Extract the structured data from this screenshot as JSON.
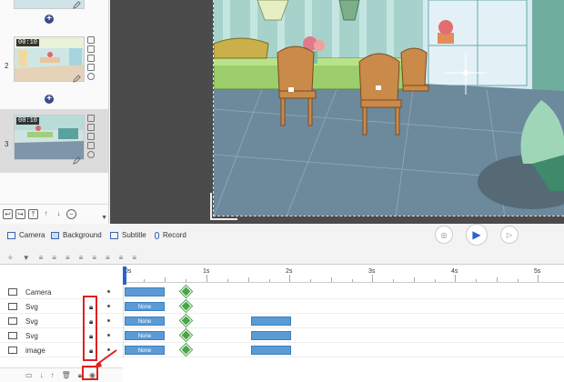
{
  "scenes": [
    {
      "number": "2",
      "time": "00:10"
    },
    {
      "number": "3",
      "time": "00:10"
    }
  ],
  "layer_tabs": [
    {
      "label": "Camera",
      "icon": "camera-icon"
    },
    {
      "label": "Background",
      "icon": "background-icon"
    },
    {
      "label": "Subtitle",
      "icon": "subtitle-icon"
    },
    {
      "label": "Record",
      "icon": "microphone-icon"
    }
  ],
  "ruler": {
    "labels": [
      "0s",
      "1s",
      "2s",
      "3s",
      "4s",
      "5s"
    ]
  },
  "tracks": [
    {
      "name": "Camera",
      "icon": "camera-icon",
      "locked": false
    },
    {
      "name": "Svg",
      "icon": "svg-icon",
      "locked": true,
      "clip": "None"
    },
    {
      "name": "Svg",
      "icon": "svg-icon",
      "locked": true,
      "clip": "None"
    },
    {
      "name": "Svg",
      "icon": "svg-icon",
      "locked": true,
      "clip": "None"
    },
    {
      "name": "image",
      "icon": "image-icon",
      "locked": true,
      "clip": "None"
    }
  ],
  "colors": {
    "accent": "#2a64c8",
    "clip": "#5b9bd5",
    "keyframe": "#4aa54a",
    "highlight": "#e02020"
  }
}
